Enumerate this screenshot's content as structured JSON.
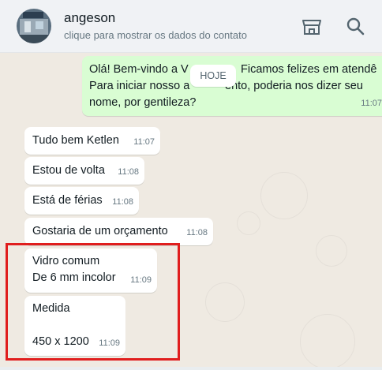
{
  "header": {
    "contact_name": "angeson",
    "contact_subtitle": "clique para mostrar os dados do contato",
    "icons": [
      "avatar",
      "store-icon",
      "search-icon"
    ]
  },
  "date_chip": "HOJE",
  "outgoing": {
    "lines": [
      "Olá! Bem-vindo a V",
      "Ficamos felizes em atendê",
      "Para iniciar nosso a",
      "ento, poderia nos dizer seu",
      "nome, por gentileza?"
    ],
    "time": "11:07"
  },
  "messages": [
    {
      "text": "Tudo bem Ketlen",
      "time": "11:07"
    },
    {
      "text": "Estou de volta",
      "time": "11:08"
    },
    {
      "text": "Está de férias",
      "time": "11:08"
    },
    {
      "text": "Gostaria de um orçamento",
      "time": "11:08"
    },
    {
      "text": "Vidro comum\nDe 6 mm incolor",
      "time": "11:09"
    },
    {
      "text": "Medida\n\n450 x 1200",
      "time": "11:09"
    }
  ],
  "colors": {
    "chat_background": "#efeae2",
    "outgoing_bubble": "#d9fdd3",
    "incoming_bubble": "#ffffff",
    "highlight_border": "#e01e1e"
  }
}
